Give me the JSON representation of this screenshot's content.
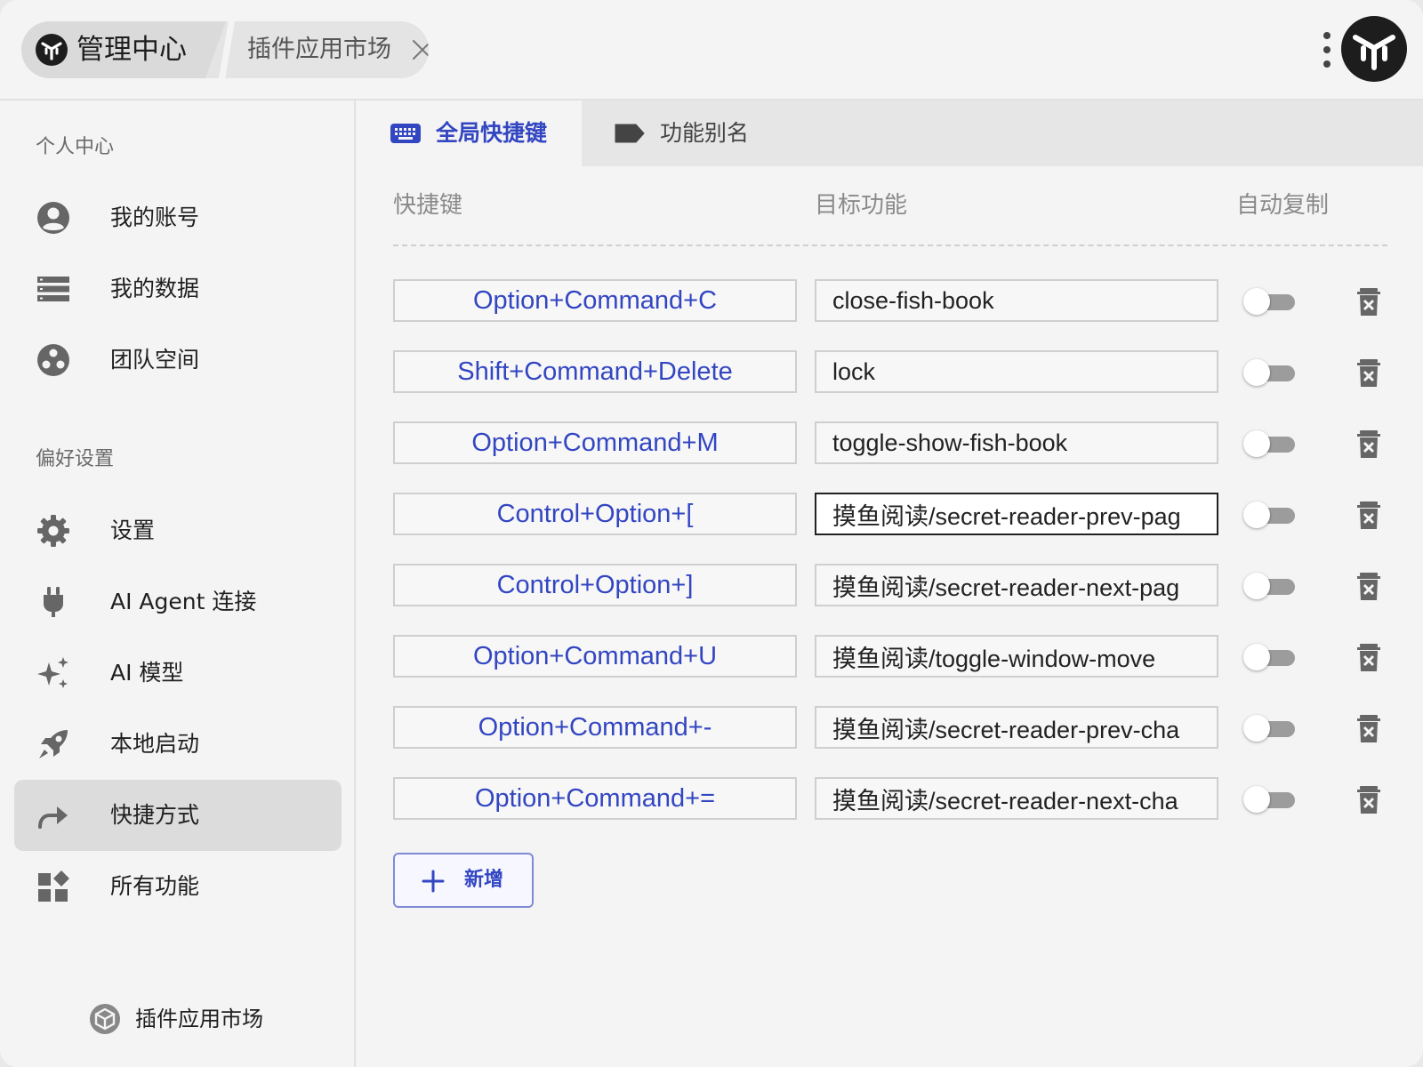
{
  "app": {
    "home_tab": "管理中心",
    "open_tab": "插件应用市场",
    "logo_icon": "yuanshu-logo-icon"
  },
  "sidebar": {
    "section_personal": "个人中心",
    "section_preferences": "偏好设置",
    "personal_items": [
      {
        "label": "我的账号",
        "icon": "account-circle-icon"
      },
      {
        "label": "我的数据",
        "icon": "storage-list-icon"
      },
      {
        "label": "团队空间",
        "icon": "team-icon"
      }
    ],
    "preference_items": [
      {
        "label": "设置",
        "icon": "gear-icon"
      },
      {
        "label": "AI Agent 连接",
        "icon": "plug-icon"
      },
      {
        "label": "AI 模型",
        "icon": "sparkles-icon"
      },
      {
        "label": "本地启动",
        "icon": "rocket-icon"
      },
      {
        "label": "快捷方式",
        "icon": "share-arrow-icon",
        "active": true
      },
      {
        "label": "所有功能",
        "icon": "widgets-icon"
      }
    ],
    "market_link": "插件应用市场"
  },
  "tabs": {
    "global_hotkeys": "全局快捷键",
    "aliases": "功能别名",
    "active": "global_hotkeys"
  },
  "table": {
    "headers": {
      "hotkey": "快捷键",
      "target": "目标功能",
      "auto_copy": "自动复制"
    },
    "rows": [
      {
        "hotkey": "Option+Command+C",
        "target": "close-fish-book",
        "auto_copy": false
      },
      {
        "hotkey": "Shift+Command+Delete",
        "target": "lock",
        "auto_copy": false
      },
      {
        "hotkey": "Option+Command+M",
        "target": "toggle-show-fish-book",
        "auto_copy": false
      },
      {
        "hotkey": "Control+Option+[",
        "target": "摸鱼阅读/secret-reader-prev-pag",
        "auto_copy": false
      },
      {
        "hotkey": "Control+Option+]",
        "target": "摸鱼阅读/secret-reader-next-pag",
        "auto_copy": false
      },
      {
        "hotkey": "Option+Command+U",
        "target": "摸鱼阅读/toggle-window-move",
        "auto_copy": false
      },
      {
        "hotkey": "Option+Command+-",
        "target": "摸鱼阅读/secret-reader-prev-cha",
        "auto_copy": false
      },
      {
        "hotkey": "Option+Command+=",
        "target": "摸鱼阅读/secret-reader-next-cha",
        "auto_copy": false
      }
    ],
    "add_button": "新增"
  },
  "colors": {
    "accent": "#3346c2",
    "background": "#f4f4f4",
    "active_nav": "#dcdcdc"
  }
}
